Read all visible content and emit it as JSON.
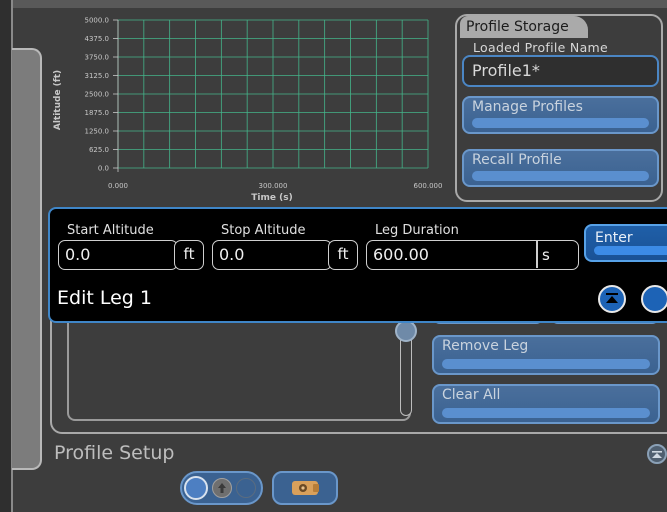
{
  "chart": {
    "ylabel": "Altitude (ft)",
    "xlabel": "Time (s)",
    "y_ticks": [
      "5000.0",
      "4375.0",
      "3750.0",
      "3125.0",
      "2500.0",
      "1875.0",
      "1250.0",
      "625.0",
      "0.0"
    ],
    "x_ticks": [
      "0.000",
      "300.000",
      "600.000"
    ],
    "grid_color": "#44b48a"
  },
  "chart_data": {
    "type": "line",
    "title": "",
    "xlabel": "Time (s)",
    "ylabel": "Altitude (ft)",
    "xlim": [
      0,
      600
    ],
    "ylim": [
      0,
      5000
    ],
    "y_ticks": [
      5000.0,
      4375.0,
      3750.0,
      3125.0,
      2500.0,
      1875.0,
      1250.0,
      625.0,
      0.0
    ],
    "x_ticks": [
      0,
      300,
      600
    ],
    "grid": true,
    "series": []
  },
  "profile_storage": {
    "title": "Profile Storage",
    "loaded_label": "Loaded Profile Name",
    "loaded_value": "Profile1*",
    "manage_label": "Manage Profiles",
    "recall_label": "Recall Profile"
  },
  "edit_leg": {
    "title": "Edit Leg 1",
    "start_label": "Start Altitude",
    "start_value": "0.0",
    "start_unit": "ft",
    "stop_label": "Stop Altitude",
    "stop_value": "0.0",
    "stop_unit": "ft",
    "duration_label": "Leg Duration",
    "duration_value": "600.00",
    "duration_unit": "s",
    "enter_label": "Enter"
  },
  "profile_setup": {
    "title": "Profile Setup",
    "remove_leg_label": "Remove Leg",
    "clear_all_label": "Clear All"
  },
  "colors": {
    "accent": "#1d63b6",
    "button": "#3b6291",
    "background": "#3d3d3d"
  }
}
